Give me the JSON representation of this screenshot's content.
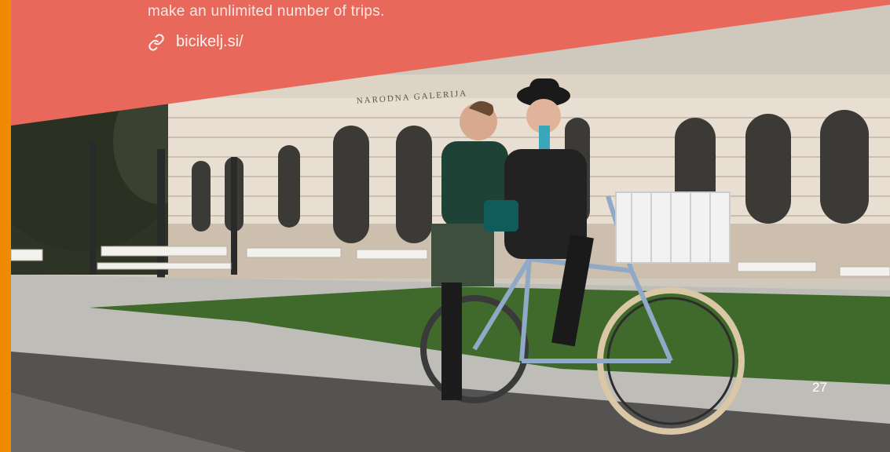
{
  "banner": {
    "description": "make an unlimited number of trips.",
    "link_text": "bicikelj.si/",
    "link_icon": "link-icon",
    "color": "#e8695c"
  },
  "photo": {
    "building_sign": "NARODNA GALERIJA"
  },
  "page_number": "27",
  "colors": {
    "edge_strip": "#f08a00",
    "banner": "#e8695c"
  }
}
